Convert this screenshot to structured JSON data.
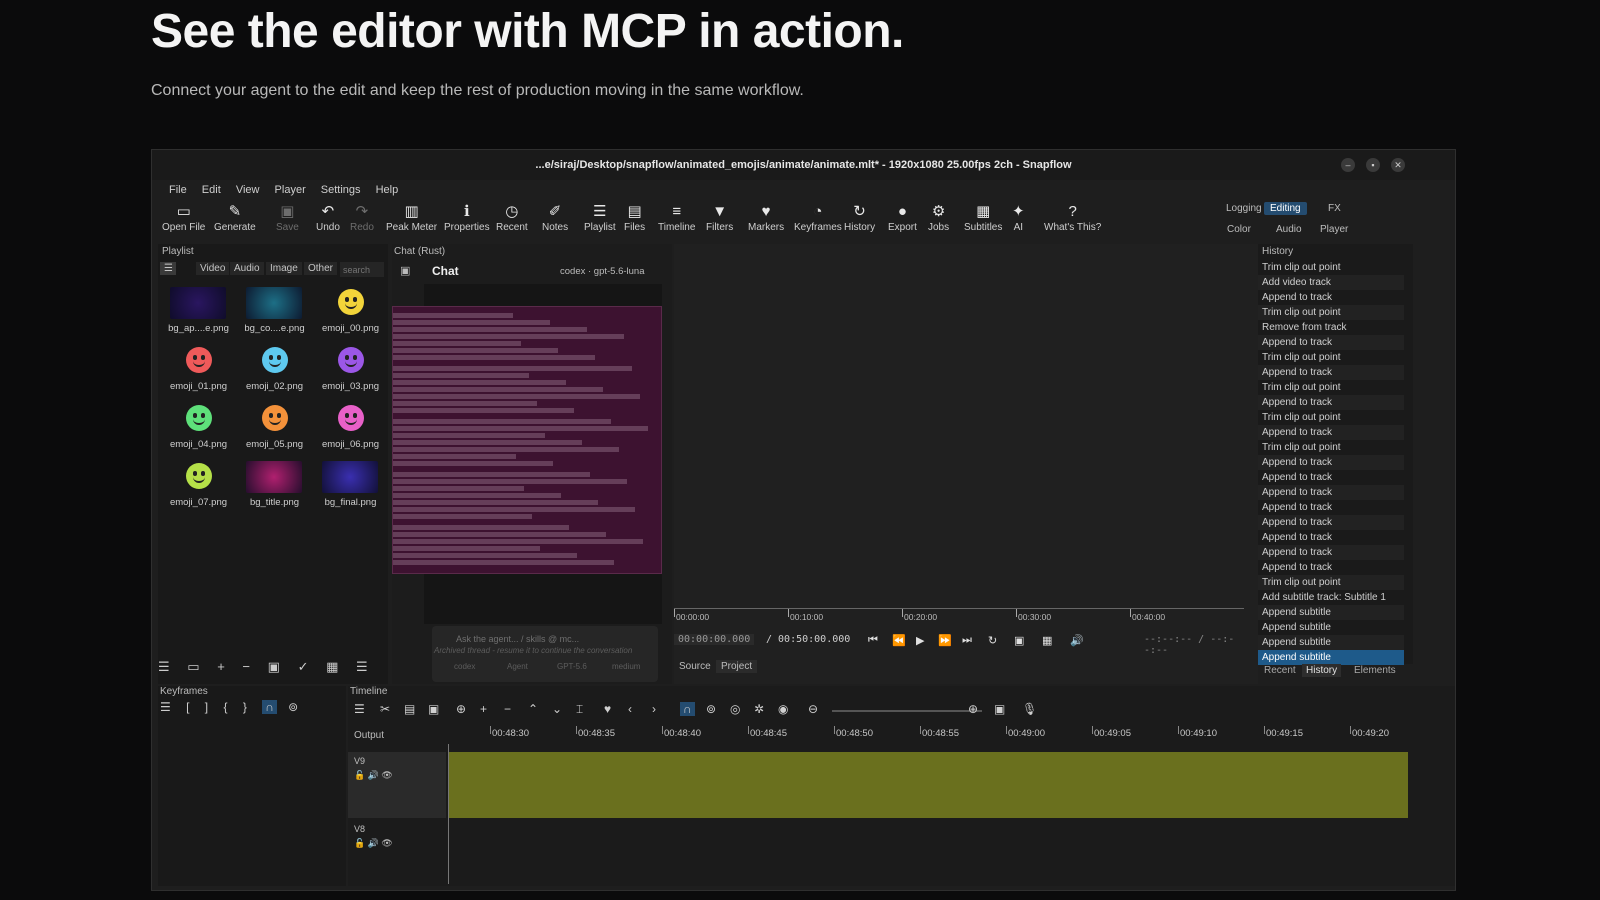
{
  "hero": {
    "title": "See the editor with MCP in action.",
    "subtitle": "Connect your agent to the edit and keep the rest of production moving in the same workflow."
  },
  "window": {
    "title": "...e/siraj/Desktop/snapflow/animated_emojis/animate/animate.mlt* - 1920x1080 25.00fps 2ch - Snapflow",
    "menu": [
      "File",
      "Edit",
      "View",
      "Player",
      "Settings",
      "Help"
    ]
  },
  "toolbar": {
    "items": [
      {
        "label": "Open File",
        "icon": "folder-icon",
        "glyph": "▭"
      },
      {
        "label": "Generate",
        "icon": "generate-icon",
        "glyph": "✎"
      },
      {
        "label": "Save",
        "icon": "save-icon",
        "glyph": "▣"
      },
      {
        "label": "Undo",
        "icon": "undo-icon",
        "glyph": "↶"
      },
      {
        "label": "Redo",
        "icon": "redo-icon",
        "glyph": "↷"
      },
      {
        "label": "Peak Meter",
        "icon": "peak-meter-icon",
        "glyph": "▥"
      },
      {
        "label": "Properties",
        "icon": "info-icon",
        "glyph": "ℹ"
      },
      {
        "label": "Recent",
        "icon": "clock-icon",
        "glyph": "◷"
      },
      {
        "label": "Notes",
        "icon": "notes-icon",
        "glyph": "✐"
      },
      {
        "label": "Playlist",
        "icon": "playlist-icon",
        "glyph": "☰"
      },
      {
        "label": "Files",
        "icon": "files-icon",
        "glyph": "▤"
      },
      {
        "label": "Timeline",
        "icon": "timeline-icon",
        "glyph": "≡"
      },
      {
        "label": "Filters",
        "icon": "filter-icon",
        "glyph": "▼"
      },
      {
        "label": "Markers",
        "icon": "marker-icon",
        "glyph": "♥"
      },
      {
        "label": "Keyframes",
        "icon": "keyframes-icon",
        "glyph": "◔"
      },
      {
        "label": "History",
        "icon": "history-icon",
        "glyph": "↻"
      },
      {
        "label": "Export",
        "icon": "export-icon",
        "glyph": "●"
      },
      {
        "label": "Jobs",
        "icon": "gear-icon",
        "glyph": "⚙"
      },
      {
        "label": "Subtitles",
        "icon": "subtitles-icon",
        "glyph": "▦"
      },
      {
        "label": "AI",
        "icon": "sparkle-icon",
        "glyph": "✦"
      },
      {
        "label": "What's This?",
        "icon": "help-icon",
        "glyph": "?"
      }
    ],
    "layouts": {
      "logging": "Logging",
      "editing": "Editing",
      "fx": "FX",
      "color": "Color",
      "audio": "Audio",
      "player": "Player"
    }
  },
  "playlist": {
    "title": "Playlist",
    "tabs": [
      "Video",
      "Audio",
      "Image",
      "Other"
    ],
    "search_placeholder": "search",
    "items": [
      {
        "label": "bg_ap....e.png",
        "color": "#2a1660"
      },
      {
        "label": "bg_co....e.png",
        "color": "#1d6f86"
      },
      {
        "label": "emoji_00.png",
        "color": "#f2d43a"
      },
      {
        "label": "emoji_01.png",
        "color": "#ef5a5a"
      },
      {
        "label": "emoji_02.png",
        "color": "#5ec9ef"
      },
      {
        "label": "emoji_03.png",
        "color": "#9b57e6"
      },
      {
        "label": "emoji_04.png",
        "color": "#5ee07a"
      },
      {
        "label": "emoji_05.png",
        "color": "#f3913a"
      },
      {
        "label": "emoji_06.png",
        "color": "#e860c8"
      },
      {
        "label": "emoji_07.png",
        "color": "#b5e048"
      },
      {
        "label": "bg_title.png",
        "color": "#b0206f"
      },
      {
        "label": "bg_final.png",
        "color": "#3a2fb0"
      }
    ]
  },
  "chat": {
    "panel_title": "Chat (Rust)",
    "heading": "Chat",
    "model": "codex · gpt-5.6-luna",
    "input_placeholder": "Ask the agent... / skills @ mc...",
    "archived_note": "Archived thread - resume it to continue the conversation",
    "chip1": "codex",
    "chip2": "Agent",
    "chip3": "GPT-5.6",
    "chip4": "medium"
  },
  "viewer": {
    "ruler": [
      "00:00:00",
      "00:10:00",
      "00:20:00",
      "00:30:00",
      "00:40:00"
    ],
    "timecode": "00:00:00.000",
    "duration": "/ 00:50:00.000",
    "inout": "--:--:-- / --:--:--",
    "source_tab": "Source",
    "project_tab": "Project"
  },
  "history": {
    "title": "History",
    "items": [
      "Trim clip out point",
      "Add video track",
      "Append to track",
      "Trim clip out point",
      "Remove from track",
      "Append to track",
      "Trim clip out point",
      "Append to track",
      "Trim clip out point",
      "Append to track",
      "Trim clip out point",
      "Append to track",
      "Trim clip out point",
      "Append to track",
      "Append to track",
      "Append to track",
      "Append to track",
      "Append to track",
      "Append to track",
      "Append to track",
      "Append to track",
      "Trim clip out point",
      "Add subtitle track: Subtitle 1",
      "Append subtitle",
      "Append subtitle",
      "Append subtitle",
      "Append subtitle"
    ],
    "tabs": [
      "Recent",
      "History",
      "Elements"
    ]
  },
  "keyframes": {
    "title": "Keyframes"
  },
  "timeline": {
    "title": "Timeline",
    "output_label": "Output",
    "ruler": [
      "00:48:30",
      "00:48:35",
      "00:48:40",
      "00:48:45",
      "00:48:50",
      "00:48:55",
      "00:49:00",
      "00:49:05",
      "00:49:10",
      "00:49:15",
      "00:49:20"
    ],
    "tracks": [
      {
        "name": "V9"
      },
      {
        "name": "V8"
      }
    ],
    "track_color": "#6a701e"
  }
}
